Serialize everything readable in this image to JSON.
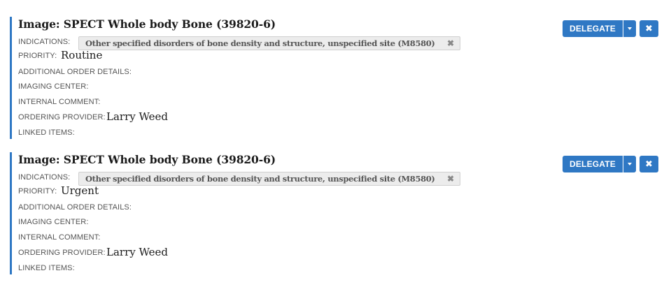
{
  "labels": {
    "indications": "INDICATIONS:",
    "priority": "PRIORITY:",
    "additional_order_details": "ADDITIONAL ORDER DETAILS:",
    "imaging_center": "IMAGING CENTER:",
    "internal_comment": "INTERNAL COMMENT:",
    "ordering_provider": "ORDERING PROVIDER:",
    "linked_items": "LINKED ITEMS:"
  },
  "actions": {
    "delegate_label": "DELEGATE",
    "remove_glyph": "✖",
    "tag_remove_glyph": "✖"
  },
  "colors": {
    "accent": "#2f78c4",
    "tag_background": "#ececec",
    "label_text": "#555555"
  },
  "icons": {
    "delegate_toggle": "chevron-down-icon",
    "remove": "close-icon",
    "tag_remove": "close-icon"
  },
  "orders": [
    {
      "title": "Image: SPECT Whole body Bone (39820-6)",
      "indication": "Other specified disorders of bone density and structure, unspecified site (M8580)",
      "priority": "Routine",
      "ordering_provider": "Larry Weed"
    },
    {
      "title": "Image: SPECT Whole body Bone (39820-6)",
      "indication": "Other specified disorders of bone density and structure, unspecified site (M8580)",
      "priority": "Urgent",
      "ordering_provider": "Larry Weed"
    }
  ]
}
